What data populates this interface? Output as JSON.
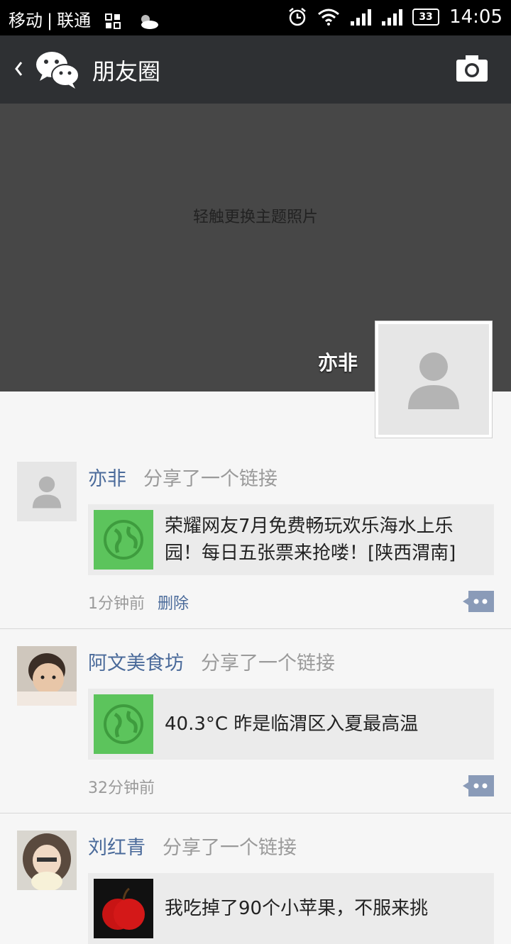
{
  "status_bar": {
    "carrier1": "移动",
    "divider": "|",
    "carrier2": "联通",
    "battery": "33",
    "time": "14:05",
    "icons": [
      "grid-icon",
      "cloudy-moon-icon",
      "alarm-icon",
      "wifi-icon",
      "signal-icon",
      "signal-icon",
      "battery-icon"
    ]
  },
  "title_bar": {
    "title": "朋友圈",
    "icons": [
      "back-icon",
      "wechat-logo-icon",
      "camera-icon"
    ]
  },
  "cover": {
    "hint": "轻触更换主题照片",
    "user_name": "亦非"
  },
  "feed": [
    {
      "name": "亦非",
      "action": "分享了一个链接",
      "link_text": "荣耀网友7月免费畅玩欢乐海水上乐园！每日五张票来抢喽！[陕西渭南]",
      "link_thumb": "globe-icon",
      "time": "1分钟前",
      "delete": "删除"
    },
    {
      "name": "阿文美食坊",
      "action": "分享了一个链接",
      "link_text": "40.3°C 昨是临渭区入夏最高温",
      "link_thumb": "globe-icon",
      "time": "32分钟前"
    },
    {
      "name": "刘红青",
      "action": "分享了一个链接",
      "link_text": "我吃掉了90个小苹果，不服来挑",
      "link_thumb": "apple-icon"
    }
  ],
  "colors": {
    "title_bar": "#2e3033",
    "cover": "#474747",
    "name_link": "#4a6a9a",
    "comment_button": "#8a9bb8",
    "link_thumb_green": "#5cc45c"
  }
}
